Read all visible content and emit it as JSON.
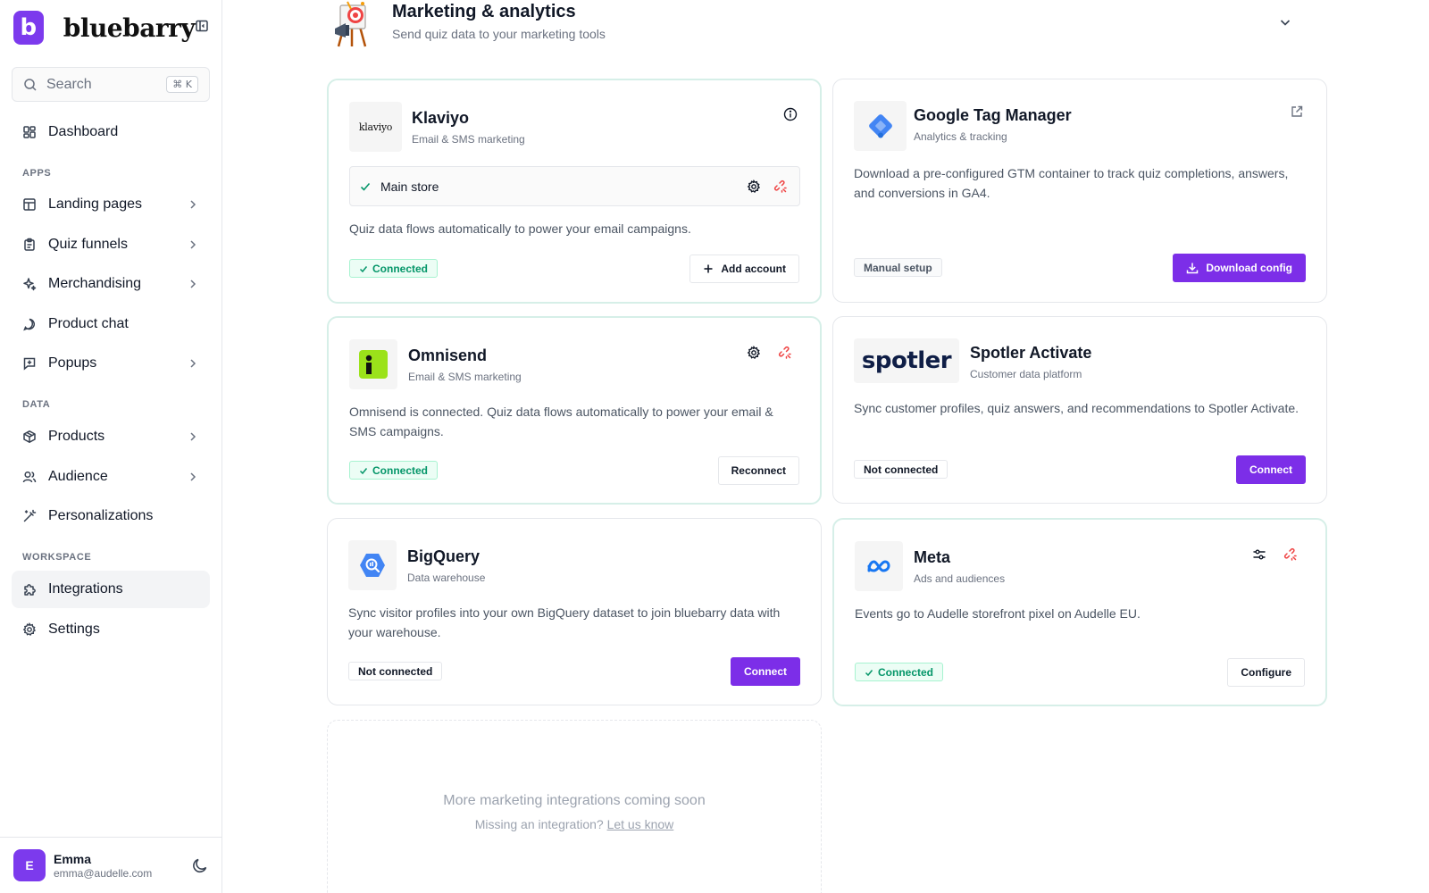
{
  "brand": {
    "logo_letter": "b",
    "name": "bluebarry"
  },
  "search": {
    "placeholder": "Search",
    "shortcut": "⌘ K"
  },
  "nav": {
    "dashboard": "Dashboard",
    "apps_label": "APPS",
    "landing_pages": "Landing pages",
    "quiz_funnels": "Quiz funnels",
    "merchandising": "Merchandising",
    "product_chat": "Product chat",
    "popups": "Popups",
    "data_label": "DATA",
    "products": "Products",
    "audience": "Audience",
    "personalizations": "Personalizations",
    "workspace_label": "WORKSPACE",
    "integrations": "Integrations",
    "settings": "Settings",
    "active": "integrations"
  },
  "user": {
    "initial": "E",
    "name": "Emma",
    "email": "emma@audelle.com"
  },
  "section": {
    "title": "Marketing & analytics",
    "subtitle": "Send quiz data to your marketing tools"
  },
  "cards": {
    "klaviyo": {
      "logo_text": "klaviyo",
      "title": "Klaviyo",
      "subtitle": "Email & SMS marketing",
      "account_name": "Main store",
      "description": "Quiz data flows automatically to power your email campaigns.",
      "status": "Connected",
      "action": "Add account"
    },
    "gtm": {
      "title": "Google Tag Manager",
      "subtitle": "Analytics & tracking",
      "description": "Download a pre-configured GTM container to track quiz completions, answers, and conversions in GA4.",
      "status": "Manual setup",
      "action": "Download config"
    },
    "omnisend": {
      "title": "Omnisend",
      "subtitle": "Email & SMS marketing",
      "description": "Omnisend is connected. Quiz data flows automatically to power your email & SMS campaigns.",
      "status": "Connected",
      "action": "Reconnect"
    },
    "spotler": {
      "logo_text": "spotler",
      "title": "Spotler Activate",
      "subtitle": "Customer data platform",
      "description": "Sync customer profiles, quiz answers, and recommendations to Spotler Activate.",
      "status": "Not connected",
      "action": "Connect"
    },
    "bigquery": {
      "title": "BigQuery",
      "subtitle": "Data warehouse",
      "description": "Sync visitor profiles into your own BigQuery dataset to join bluebarry data with your warehouse.",
      "status": "Not connected",
      "action": "Connect"
    },
    "meta": {
      "title": "Meta",
      "subtitle": "Ads and audiences",
      "description": "Events go to Audelle storefront pixel on Audelle EU.",
      "status": "Connected",
      "action": "Configure"
    }
  },
  "coming_soon": {
    "title": "More marketing integrations coming soon",
    "subtitle": "Missing an integration?",
    "link": "Let us know"
  },
  "colors": {
    "accent": "#7c3aed",
    "connected_text": "#059669",
    "connected_bg": "#ecfdf5",
    "disconnect_icon": "#ef4444"
  }
}
